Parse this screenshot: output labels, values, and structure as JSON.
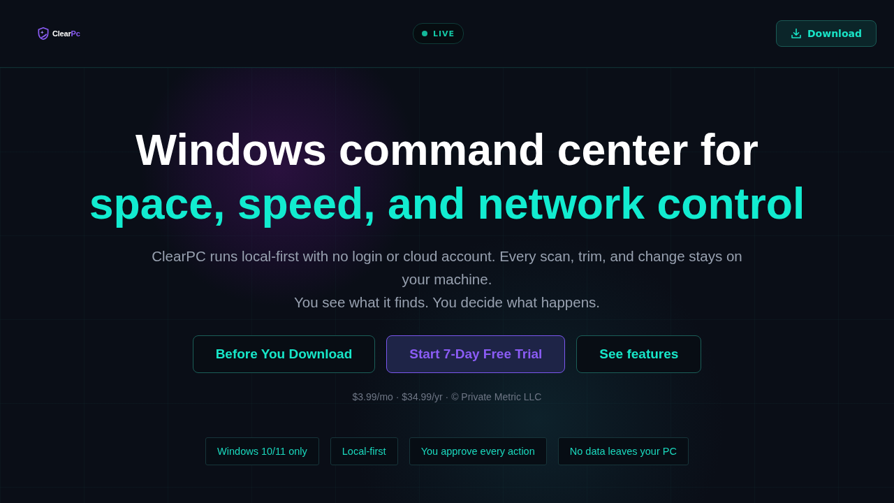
{
  "header": {
    "logo": {
      "name": "Clear",
      "accent": "Pc"
    },
    "status_badge": {
      "label": "LIVE"
    },
    "download_button": {
      "label": "Download"
    }
  },
  "hero": {
    "headline": "Windows command center for",
    "headline_accent": "space, speed, and network control",
    "description": [
      "ClearPC runs local-first with no login or cloud account. Every scan, trim, and change stays on your machine.",
      "You see what it finds. You decide what happens."
    ],
    "actions": [
      {
        "label": "Before You Download",
        "kind": "outline"
      },
      {
        "label": "Start 7-Day Free Trial",
        "kind": "primary"
      },
      {
        "label": "See features",
        "kind": "outline"
      }
    ],
    "pricing_note": "$3.99/mo · $34.99/yr · © Private Metric LLC",
    "tags": [
      "Windows 10/11 only",
      "Local-first",
      "You approve every action",
      "No data leaves your PC"
    ]
  }
}
